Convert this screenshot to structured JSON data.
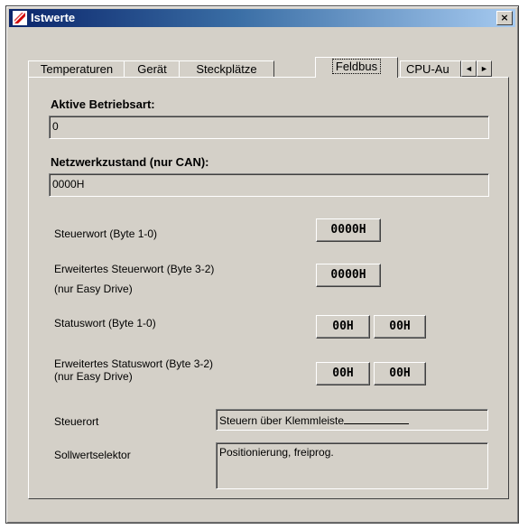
{
  "window": {
    "title": "Istwerte",
    "close_label": "×"
  },
  "tabs": [
    {
      "label": "Temperaturen"
    },
    {
      "label": "Gerät"
    },
    {
      "label": "Steckplätze"
    },
    {
      "label": "Feldbus",
      "active": true
    },
    {
      "label": "CPU-Au"
    }
  ],
  "tab_scroll": {
    "left": "◄",
    "right": "►"
  },
  "betriebsart": {
    "label": "Aktive Betriebsart:",
    "value": "0"
  },
  "netzwerk": {
    "label": "Netzwerkzustand (nur CAN):",
    "value": "0000H"
  },
  "steuerwort": {
    "label": "Steuerwort (Byte 1-0)",
    "value": "0000H"
  },
  "erw_steuerwort": {
    "label": "Erweitertes Steuerwort (Byte 3-2)",
    "note": "(nur Easy Drive)",
    "value": "0000H"
  },
  "statuswort": {
    "label": "Statuswort (Byte 1-0)",
    "values": [
      "00H",
      "00H"
    ]
  },
  "erw_statuswort": {
    "label": "Erweitertes Statuswort (Byte 3-2)",
    "note": "(nur Easy Drive)",
    "values": [
      "00H",
      "00H"
    ]
  },
  "steuerort": {
    "label": "Steuerort",
    "value": "Steuern über Klemmleiste"
  },
  "sollwert": {
    "label": "Sollwertselektor",
    "value": "Positionierung, freiprog."
  }
}
